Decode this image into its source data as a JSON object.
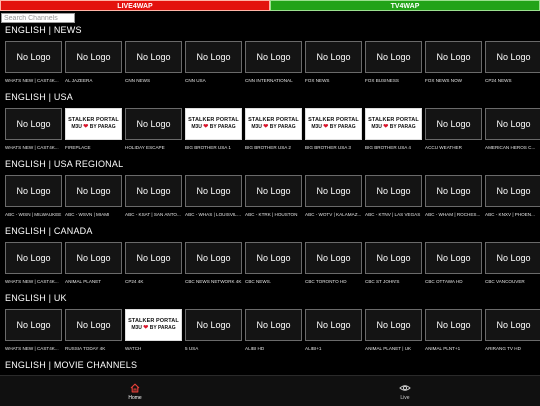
{
  "top_tabs": {
    "live": "LIVE4WAP",
    "tv": "TV4WAP"
  },
  "search": {
    "placeholder": "Search Channels"
  },
  "no_logo": "No Logo",
  "portal_logo": {
    "line1": "STALKER PORTAL",
    "line2a": "M3U",
    "heart": "❤",
    "line2b": "BY PARAG"
  },
  "sections": [
    {
      "title": "ENGLISH | NEWS",
      "channels": [
        {
          "name": "WHATS NEW | CAST4K...",
          "logo": "none"
        },
        {
          "name": "AL JAZEERA",
          "logo": "none"
        },
        {
          "name": "CNN NEWS",
          "logo": "none"
        },
        {
          "name": "CNN USA",
          "logo": "none"
        },
        {
          "name": "CNN INTERNATIONAL",
          "logo": "none"
        },
        {
          "name": "FOX NEWS",
          "logo": "none"
        },
        {
          "name": "FOX BUSINESS",
          "logo": "none"
        },
        {
          "name": "FOX NEWS NOW",
          "logo": "none"
        },
        {
          "name": "CP24 NEWS",
          "logo": "none"
        }
      ]
    },
    {
      "title": "ENGLISH | USA",
      "channels": [
        {
          "name": "WHATS NEW | CAST4K...",
          "logo": "none"
        },
        {
          "name": "FIREPLACE",
          "logo": "portal"
        },
        {
          "name": "HOLIDAY ESCAPE",
          "logo": "none"
        },
        {
          "name": "BIG BROTHER USA 1",
          "logo": "portal"
        },
        {
          "name": "BIG BROTHER USA 2",
          "logo": "portal"
        },
        {
          "name": "BIG BROTHER USA 3",
          "logo": "portal"
        },
        {
          "name": "BIG BROTHER USA 4",
          "logo": "portal"
        },
        {
          "name": "ACCU WEATHER",
          "logo": "none"
        },
        {
          "name": "AMERICAN HEROS C...",
          "logo": "none"
        }
      ]
    },
    {
      "title": "ENGLISH | USA REGIONAL",
      "channels": [
        {
          "name": "ABC - WISN | MILWAUKEE",
          "logo": "none"
        },
        {
          "name": "ABC - WSVN | MIAMI",
          "logo": "none"
        },
        {
          "name": "ABC - KSAT | SAN ANTO...",
          "logo": "none"
        },
        {
          "name": "ABC - WHAS | LOUISVILLE",
          "logo": "none"
        },
        {
          "name": "ABC - KTRK | HOUSTON",
          "logo": "none"
        },
        {
          "name": "ABC - WOTV | KALAMAZ...",
          "logo": "none"
        },
        {
          "name": "ABC - KTNV | LAS VEGAS",
          "logo": "none"
        },
        {
          "name": "ABC - WHAM | ROCHES...",
          "logo": "none"
        },
        {
          "name": "ABC - KNXV | PHOEN...",
          "logo": "none"
        }
      ]
    },
    {
      "title": "ENGLISH | CANADA",
      "channels": [
        {
          "name": "WHATS NEW | CAST4K...",
          "logo": "none"
        },
        {
          "name": "ANIMAL PLANET",
          "logo": "none"
        },
        {
          "name": "CP24 4K",
          "logo": "none"
        },
        {
          "name": "CBC NEWS NETWORK 4K",
          "logo": "none"
        },
        {
          "name": "CBC NEWS.",
          "logo": "none"
        },
        {
          "name": "CBC TORONTO HD",
          "logo": "none"
        },
        {
          "name": "CBC ST JOHN'S",
          "logo": "none"
        },
        {
          "name": "CBC OTTAWA HD",
          "logo": "none"
        },
        {
          "name": "CBC VANCOUVER",
          "logo": "none"
        }
      ]
    },
    {
      "title": "ENGLISH | UK",
      "channels": [
        {
          "name": "WHATS NEW | CAST4K...",
          "logo": "none"
        },
        {
          "name": "RUSSIA TODAY 4K",
          "logo": "none"
        },
        {
          "name": "WATCH",
          "logo": "portal"
        },
        {
          "name": "5 USA",
          "logo": "none"
        },
        {
          "name": "ALIBI HD",
          "logo": "none"
        },
        {
          "name": "ALIBI+1",
          "logo": "none"
        },
        {
          "name": "ANIMAL PLANET | UK",
          "logo": "none"
        },
        {
          "name": "ANIMAL PLNT+1",
          "logo": "none"
        },
        {
          "name": "ARIRANG TV HD",
          "logo": "none"
        }
      ]
    },
    {
      "title": "ENGLISH | MOVIE CHANNELS",
      "channels": []
    }
  ],
  "bottom_nav": [
    {
      "label": "Home",
      "icon": "home-icon",
      "active": true
    },
    {
      "label": "Live",
      "icon": "eye-icon",
      "active": false
    }
  ],
  "colors": {
    "live_tab": "#e3120d",
    "tv_tab": "#22a318",
    "active_nav": "#e8413a"
  }
}
